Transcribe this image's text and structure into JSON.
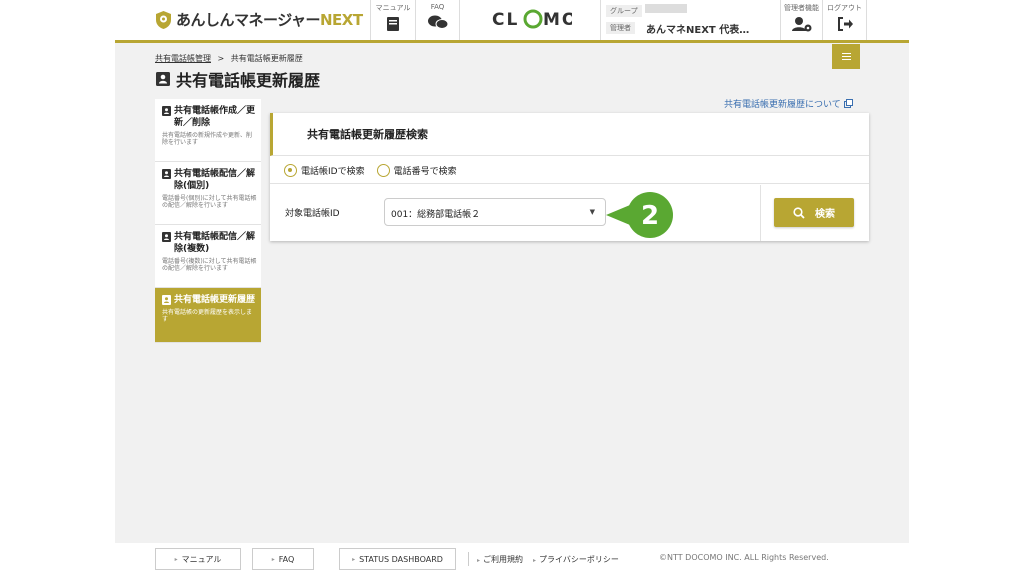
{
  "header": {
    "logo_text": "あんしんマネージャー",
    "logo_next": "NEXT",
    "manual_label": "マニュアル",
    "faq_label": "FAQ",
    "clomo_text": "CLOMO",
    "group_tag": "グループ",
    "admin_tag": "管理者",
    "admin_name": "あんマネNEXT 代表…",
    "admin_func_label": "管理者機能",
    "logout_label": "ログアウト"
  },
  "breadcrumb": {
    "parent": "共有電話帳管理",
    "separator": ">",
    "current": "共有電話帳更新履歴"
  },
  "page_title": "共有電話帳更新履歴",
  "about_link": "共有電話帳更新履歴について",
  "sidebar": {
    "items": [
      {
        "title": "共有電話帳作成／更新／削除",
        "desc": "共有電話帳の新規作成や更新、削除を行います",
        "active": false
      },
      {
        "title": "共有電話帳配信／解除(個別)",
        "desc": "電話番号(個別)に対して共有電話帳の配信／解除を行います",
        "active": false
      },
      {
        "title": "共有電話帳配信／解除(複数)",
        "desc": "電話番号(複数)に対して共有電話帳の配信／解除を行います",
        "active": false
      },
      {
        "title": "共有電話帳更新履歴",
        "desc": "共有電話帳の更新履歴を表示します",
        "active": true
      }
    ]
  },
  "search": {
    "heading": "共有電話帳更新履歴検索",
    "radio_id": "電話帳IDで検索",
    "radio_number": "電話番号で検索",
    "selected_radio": "radio_id",
    "field_label": "対象電話帳ID",
    "select_value": "001：総務部電話帳２",
    "button_label": "検索"
  },
  "badge_number": "2",
  "footer": {
    "manual": "マニュアル",
    "faq": "FAQ",
    "status": "STATUS DASHBOARD",
    "terms": "ご利用規約",
    "privacy": "プライバシーポリシー",
    "copyright": "©NTT DOCOMO INC. ALL Rights Reserved."
  },
  "colors": {
    "accent": "#b8a633",
    "badge_green": "#5aa832",
    "link": "#3a6fb0"
  }
}
